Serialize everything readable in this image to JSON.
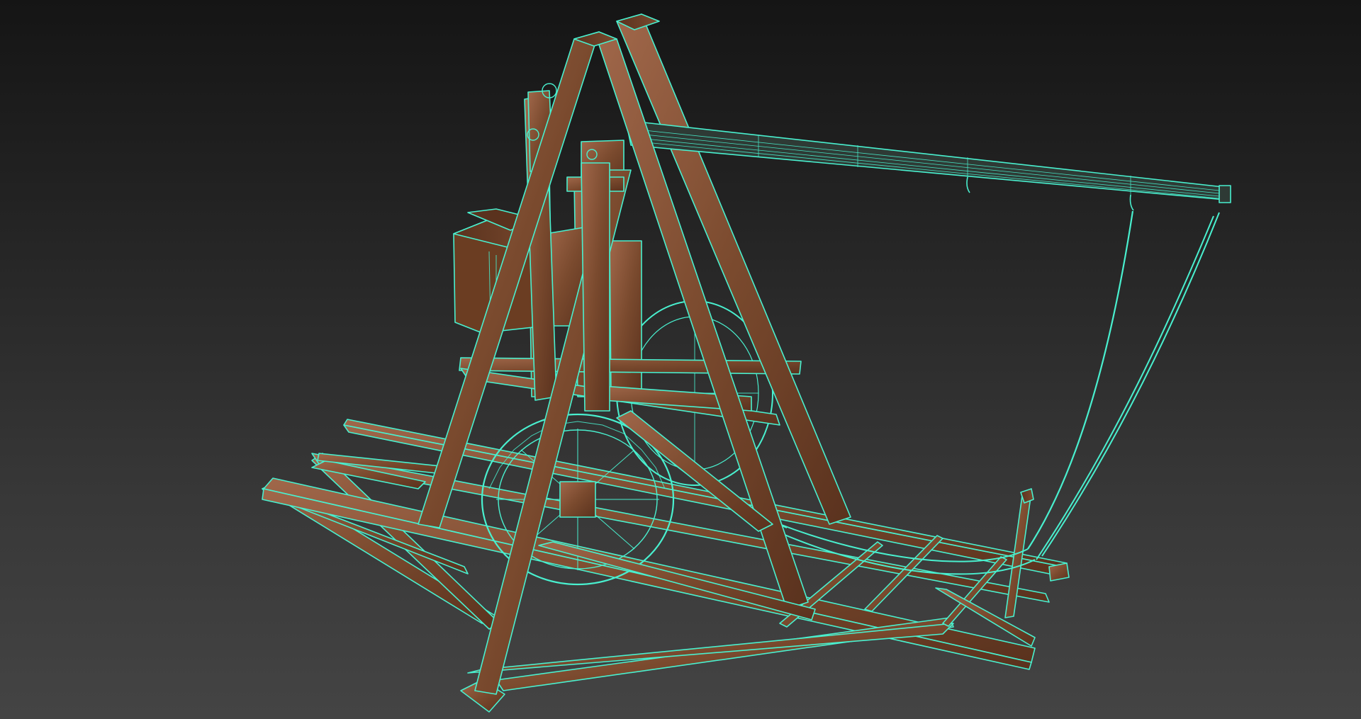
{
  "viewport": {
    "background_top": "#151515",
    "background_bottom": "#444444",
    "wireframe_color": "#49f0cf",
    "wood_color": "#7a4a2e",
    "wood_dark": "#5a321e",
    "wood_light": "#a0674a"
  },
  "scene": {
    "object": "trebuchet-model",
    "shading": "wood-texture-with-wireframe-overlay"
  }
}
